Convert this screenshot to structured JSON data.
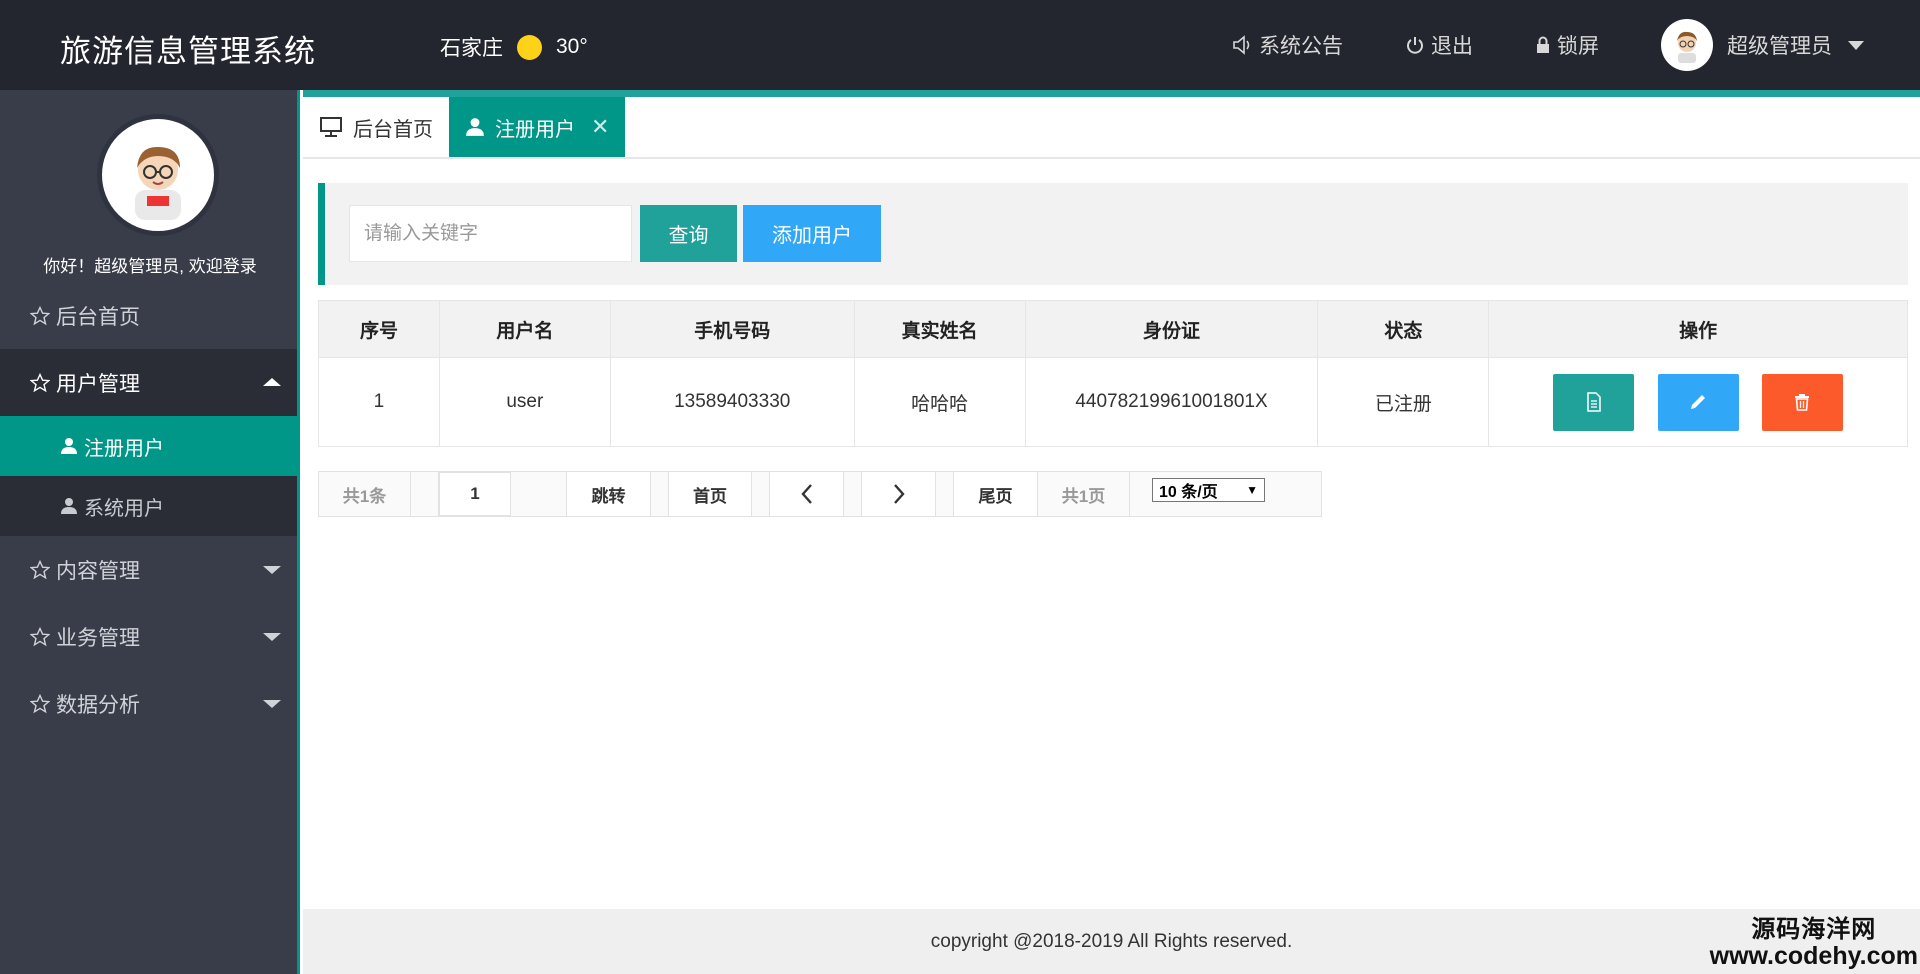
{
  "header": {
    "title": "旅游信息管理系统",
    "city": "石家庄",
    "temperature": "30°",
    "notice": "系统公告",
    "logout": "退出",
    "lock": "锁屏",
    "user": "超级管理员"
  },
  "sidebar": {
    "welcome": "你好！超级管理员, 欢迎登录",
    "items": [
      {
        "label": "后台首页"
      },
      {
        "label": "用户管理",
        "children": [
          {
            "label": "注册用户"
          },
          {
            "label": "系统用户"
          }
        ]
      },
      {
        "label": "内容管理"
      },
      {
        "label": "业务管理"
      },
      {
        "label": "数据分析"
      }
    ]
  },
  "tabs": [
    {
      "label": "后台首页"
    },
    {
      "label": "注册用户"
    }
  ],
  "toolbar": {
    "search_placeholder": "请输入关键字",
    "query": "查询",
    "add": "添加用户"
  },
  "table": {
    "columns": [
      "序号",
      "用户名",
      "手机号码",
      "真实姓名",
      "身份证",
      "状态",
      "操作"
    ],
    "rows": [
      {
        "index": "1",
        "username": "user",
        "phone": "13589403330",
        "realname": "哈哈哈",
        "idcard": "44078219961001801X",
        "status": "已注册"
      }
    ]
  },
  "pager": {
    "total": "共1条",
    "page_input": "1",
    "jump": "跳转",
    "first": "首页",
    "last": "尾页",
    "pages": "共1页",
    "per_page": "10 条/页"
  },
  "footer": {
    "copyright": "copyright @2018-2019 All Rights reserved."
  },
  "watermark": {
    "line1": "源码海洋网",
    "line2": "www.codehy.com"
  },
  "colors": {
    "header_bg": "#23262e",
    "sidebar_bg": "#393d49",
    "accent": "#009688",
    "blue": "#31a8f7",
    "danger": "#fc5a2b"
  }
}
